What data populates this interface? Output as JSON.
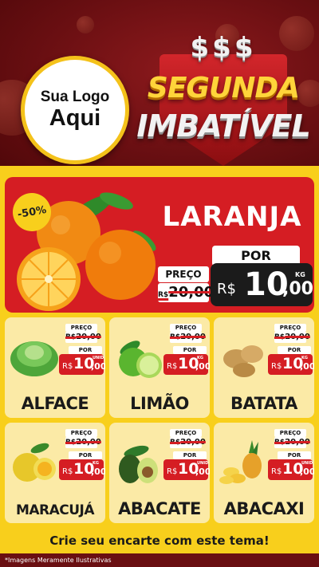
{
  "logo": {
    "line1": "Sua Logo",
    "line2": "Aqui"
  },
  "campaign": {
    "dollars": "$$$",
    "line1": "SEGUNDA",
    "line2": "IMBATÍVEL"
  },
  "hero": {
    "discount": "-50%",
    "name": "LARANJA",
    "old_label": "PREÇO",
    "old_currency": "R$",
    "old_price": "20,00",
    "new_label": "POR",
    "new_currency": "R$",
    "new_int": "10",
    "new_dec": ",00",
    "unit": "KG"
  },
  "products": [
    {
      "name": "ALFACE",
      "old_label": "PREÇO",
      "old_currency": "R$",
      "old_price": "20,00",
      "new_label": "POR",
      "new_currency": "R$",
      "new_int": "10",
      "new_dec": ",00",
      "unit": "UNID",
      "icon": "lettuce-icon"
    },
    {
      "name": "LIMÃO",
      "old_label": "PREÇO",
      "old_currency": "R$",
      "old_price": "20,00",
      "new_label": "POR",
      "new_currency": "R$",
      "new_int": "10",
      "new_dec": ",00",
      "unit": "KG",
      "icon": "lime-icon"
    },
    {
      "name": "BATATA",
      "old_label": "PREÇO",
      "old_currency": "R$",
      "old_price": "20,00",
      "new_label": "POR",
      "new_currency": "R$",
      "new_int": "10",
      "new_dec": ",00",
      "unit": "KG",
      "icon": "potato-icon"
    },
    {
      "name": "MARACUJÁ",
      "old_label": "PREÇO",
      "old_currency": "R$",
      "old_price": "20,00",
      "new_label": "POR",
      "new_currency": "R$",
      "new_int": "10",
      "new_dec": ",00",
      "unit": "KG",
      "icon": "passion-fruit-icon"
    },
    {
      "name": "ABACATE",
      "old_label": "PREÇO",
      "old_currency": "R$",
      "old_price": "20,00",
      "new_label": "POR",
      "new_currency": "R$",
      "new_int": "10",
      "new_dec": ",00",
      "unit": "UNID",
      "icon": "avocado-icon"
    },
    {
      "name": "ABACAXI",
      "old_label": "PREÇO",
      "old_currency": "R$",
      "old_price": "20,00",
      "new_label": "POR",
      "new_currency": "R$",
      "new_int": "10",
      "new_dec": ",00",
      "unit": "UNID",
      "icon": "pineapple-icon"
    }
  ],
  "cta": "Crie seu encarte com este tema!",
  "footer": "*Imagens Meramente Ilustrativas",
  "colors": {
    "red": "#d51d23",
    "yellow": "#f8cf1c",
    "dark_red": "#6a0f12",
    "card": "#fbeaa6"
  }
}
